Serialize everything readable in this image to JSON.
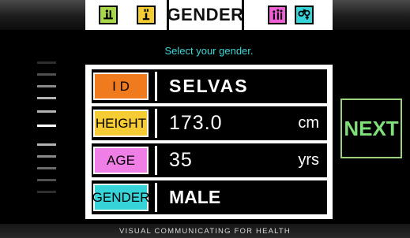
{
  "header": {
    "title": "GENDER",
    "icons": [
      "id-icon",
      "info-icon",
      "stats-icon",
      "gender-icon"
    ]
  },
  "subtitle": "Select your gender.",
  "fields": [
    {
      "label": "I D",
      "value": "SELVAS",
      "unit": "",
      "color": "#f07a1e"
    },
    {
      "label": "HEIGHT",
      "value": "173.0",
      "unit": "cm",
      "color": "#f5cc34"
    },
    {
      "label": "AGE",
      "value": "35",
      "unit": "yrs",
      "color": "#ef7ee6"
    },
    {
      "label": "GENDER",
      "value": "MALE",
      "unit": "",
      "color": "#36d3d8"
    }
  ],
  "scale": {
    "levels": 10,
    "current": 6
  },
  "next_label": "NEXT",
  "footer": "VISUAL COMMUNICATING FOR HEALTH",
  "colors": {
    "accent_text": "#39d8d8",
    "next": "#7fe07a"
  }
}
